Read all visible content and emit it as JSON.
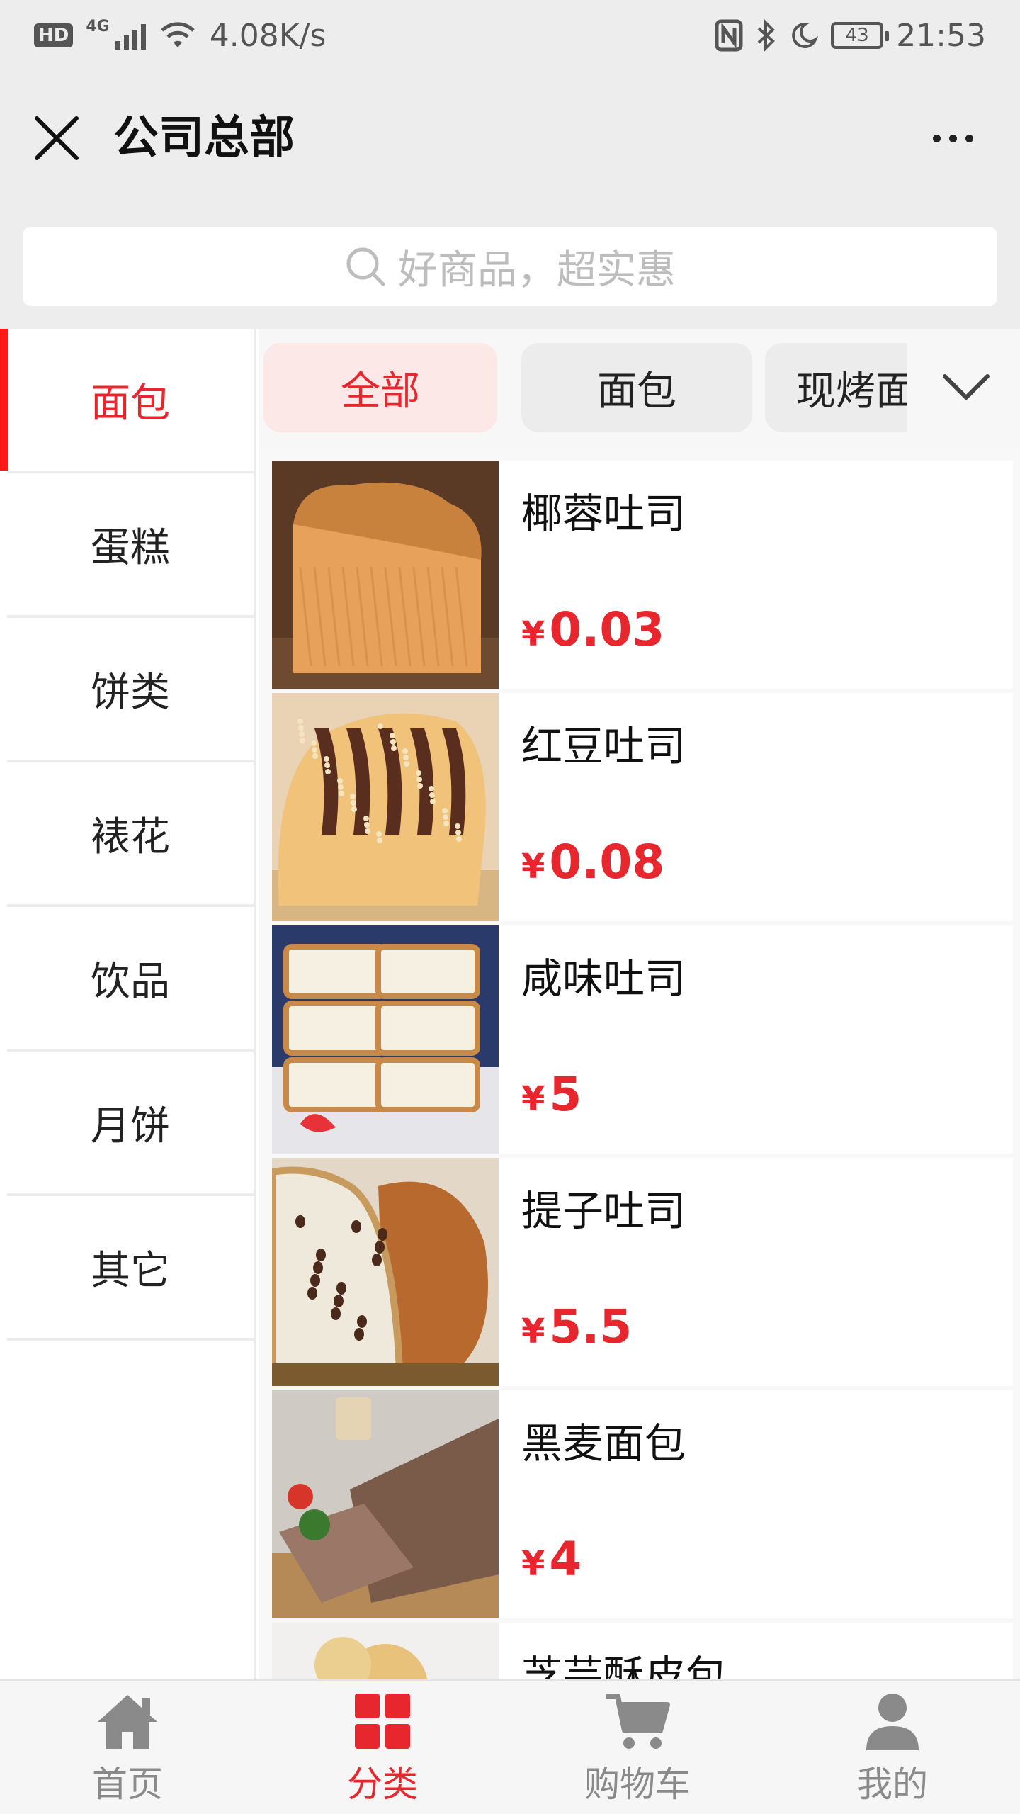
{
  "status_bar": {
    "hd": "HD",
    "network": "4G",
    "speed": "4.08K/s",
    "battery": "43",
    "time": "21:53"
  },
  "header": {
    "title": "公司总部"
  },
  "search": {
    "placeholder": "好商品，超实惠"
  },
  "sidebar": {
    "items": [
      {
        "label": "面包",
        "active": true
      },
      {
        "label": "蛋糕"
      },
      {
        "label": "饼类"
      },
      {
        "label": "裱花"
      },
      {
        "label": "饮品"
      },
      {
        "label": "月饼"
      },
      {
        "label": "其它"
      }
    ]
  },
  "chips": [
    {
      "label": "全部",
      "active": true
    },
    {
      "label": "面包"
    },
    {
      "label": "现烤面包"
    }
  ],
  "products": [
    {
      "name": "椰蓉吐司",
      "currency": "¥",
      "price": "0.03"
    },
    {
      "name": "红豆吐司",
      "currency": "¥",
      "price": "0.08"
    },
    {
      "name": "咸味吐司",
      "currency": "¥",
      "price": "5"
    },
    {
      "name": "提子吐司",
      "currency": "¥",
      "price": "5.5"
    },
    {
      "name": "黑麦面包",
      "currency": "¥",
      "price": "4"
    },
    {
      "name": "芝芸酥皮包",
      "currency": "¥",
      "price": ""
    }
  ],
  "tabbar": {
    "items": [
      {
        "label": "首页",
        "icon": "home-icon"
      },
      {
        "label": "分类",
        "icon": "category-icon",
        "active": true
      },
      {
        "label": "购物车",
        "icon": "cart-icon"
      },
      {
        "label": "我的",
        "icon": "user-icon"
      }
    ]
  },
  "colors": {
    "accent": "#e8262d",
    "background_bar": "#ededed",
    "chip_active_bg": "#fde8e8"
  }
}
